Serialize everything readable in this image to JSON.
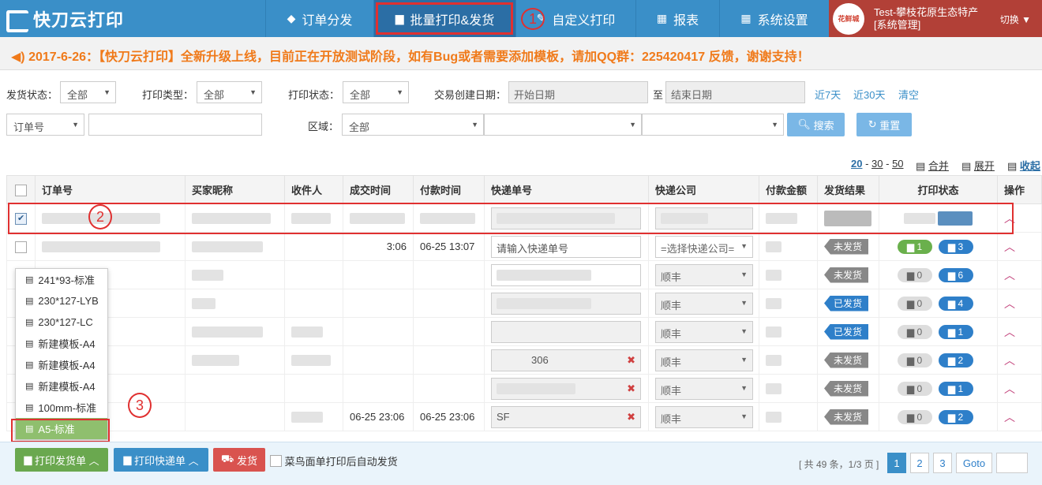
{
  "app": {
    "logo": "快刀云打印"
  },
  "nav": [
    {
      "label": "订单分发",
      "icon": "cubes-icon"
    },
    {
      "label": "批量打印&发货",
      "icon": "printer-icon"
    },
    {
      "label": "自定义打印",
      "icon": "edit-icon"
    },
    {
      "label": "报表",
      "icon": "calendar-icon"
    },
    {
      "label": "系统设置",
      "icon": "grid-icon"
    }
  ],
  "user": {
    "name": "Test-攀枝花原生态特产",
    "role": "[系统管理]",
    "switch": "切换",
    "avatar_text": "花鲜城"
  },
  "annotations": {
    "one": "1",
    "two": "2",
    "three": "3"
  },
  "notice": "2017-6-26：【快刀云打印】全新升级上线，目前正在开放测试阶段，如有Bug或者需要添加模板，请加QQ群：225420417 反馈，谢谢支持！",
  "filters": {
    "ship_status_label": "发货状态：",
    "ship_status": "全部",
    "print_type_label": "打印类型：",
    "print_type": "全部",
    "print_status_label": "打印状态：",
    "print_status": "全部",
    "date_label": "交易创建日期：",
    "start_placeholder": "开始日期",
    "to": "至",
    "end_placeholder": "结束日期",
    "last7": "近7天",
    "last30": "近30天",
    "clear": "清空",
    "order_type": "订单号",
    "region_label": "区域：",
    "region": "全部",
    "search": "搜索",
    "reset": "重置"
  },
  "pager_top": {
    "s20": "20",
    "sep1": " - ",
    "s30": "30",
    "sep2": " - ",
    "s50": "50",
    "merge": "合并",
    "expand": "展开",
    "collapse": "收起"
  },
  "table": {
    "headers": [
      "订单号",
      "买家昵称",
      "收件人",
      "成交时间",
      "付款时间",
      "快递单号",
      "快递公司",
      "付款金额",
      "发货结果",
      "打印状态",
      "操作"
    ],
    "rows": [
      {
        "deal_time": "",
        "pay_time": "",
        "tracking": "",
        "courier": "",
        "result": "",
        "p1": "",
        "p2": ""
      },
      {
        "deal_time": "3:06",
        "pay_time": "06-25 13:07",
        "tracking": "请输入快递单号",
        "courier": "=选择快递公司=",
        "result": "未发货",
        "p1": "1",
        "p2": "3"
      },
      {
        "deal_time": "",
        "pay_time": "",
        "tracking": "",
        "courier": "顺丰",
        "result": "未发货",
        "p1": "0",
        "p2": "6"
      },
      {
        "deal_time": "",
        "pay_time": "",
        "tracking": "",
        "courier": "顺丰",
        "result": "已发货",
        "p1": "0",
        "p2": "4"
      },
      {
        "deal_time": "",
        "pay_time": "",
        "tracking": "",
        "courier": "顺丰",
        "result": "已发货",
        "p1": "0",
        "p2": "1"
      },
      {
        "deal_time": "",
        "pay_time": "",
        "tracking": "306",
        "courier": "顺丰",
        "result": "未发货",
        "p1": "0",
        "p2": "2"
      },
      {
        "deal_time": "",
        "pay_time": "",
        "tracking": "",
        "courier": "顺丰",
        "result": "未发货",
        "p1": "0",
        "p2": "1"
      },
      {
        "deal_time": "06-25 23:06",
        "pay_time": "06-25 23:06",
        "tracking": "SF",
        "courier": "顺丰",
        "result": "未发货",
        "p1": "0",
        "p2": "2"
      }
    ]
  },
  "templates": [
    "241*93-标准",
    "230*127-LYB",
    "230*127-LC",
    "新建模板-A4",
    "新建模板-A4",
    "新建模板-A4",
    "100mm-标准",
    "A5-标准"
  ],
  "bottom": {
    "print_invoice": "打印发货单",
    "print_express": "打印快递单",
    "ship": "发货",
    "auto_ship": "菜鸟面单打印后自动发货",
    "summary": "[ 共 49 条，1/3 页 ]",
    "p1": "1",
    "p2": "2",
    "p3": "3",
    "goto": "Goto"
  }
}
